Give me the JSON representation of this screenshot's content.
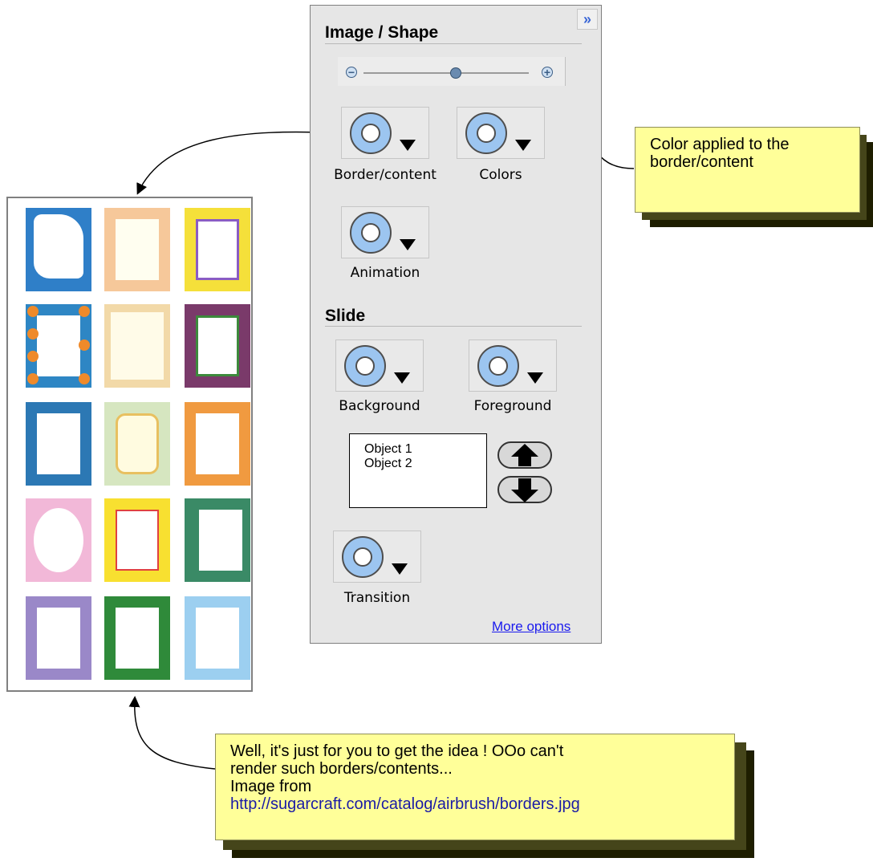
{
  "panel": {
    "collapse_glyph": "»",
    "image_shape": {
      "title": "Image / Shape",
      "zoom_out_glyph": "−",
      "zoom_in_glyph": "+",
      "zoom_level": 0.56,
      "buttons": [
        {
          "label": "Border/content",
          "icon": "ring-dropdown-icon"
        },
        {
          "label": "Colors",
          "icon": "ring-dropdown-icon"
        },
        {
          "label": "Animation",
          "icon": "ring-dropdown-icon"
        }
      ]
    },
    "slide": {
      "title": "Slide",
      "buttons": [
        {
          "label": "Background",
          "icon": "ring-dropdown-icon"
        },
        {
          "label": "Foreground",
          "icon": "ring-dropdown-icon"
        },
        {
          "label": "Transition",
          "icon": "ring-dropdown-icon"
        }
      ],
      "objects": [
        "Object 1",
        "Object 2"
      ]
    },
    "more_options": "More options"
  },
  "callouts": {
    "colors_note": {
      "line1": "Color applied to the",
      "line2": "border/content"
    },
    "image_note": {
      "line1": "Well, it's just for you to get the idea ! OOo can't",
      "line2": "render such borders/contents...",
      "line3": "Image from",
      "url": "http://sugarcraft.com/catalog/airbrush/borders.jpg"
    }
  },
  "colors": {
    "panel_bg": "#e6e6e6",
    "ring_fill": "#9cc5f0",
    "note_bg": "#ffff99",
    "link": "#1a1aee"
  }
}
